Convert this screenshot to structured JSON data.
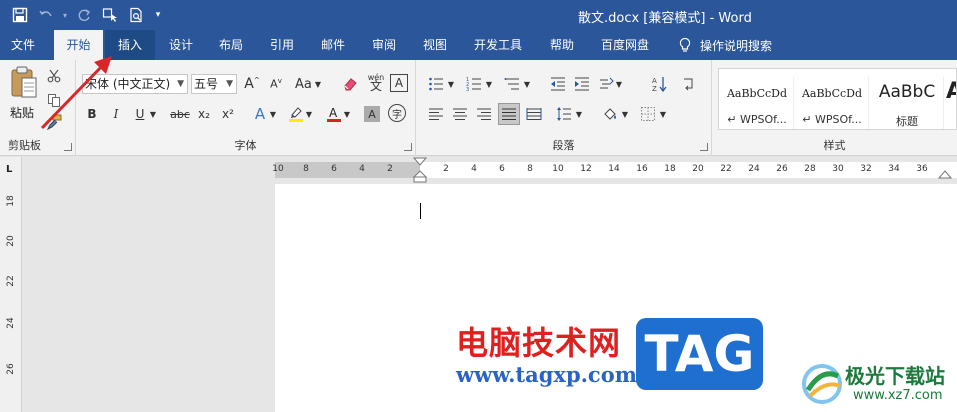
{
  "window": {
    "title": "散文.docx [兼容模式]  -  Word"
  },
  "tabs": [
    {
      "label": "文件",
      "state": "normal"
    },
    {
      "label": "开始",
      "state": "active"
    },
    {
      "label": "插入",
      "state": "hover"
    },
    {
      "label": "设计",
      "state": "normal"
    },
    {
      "label": "布局",
      "state": "normal"
    },
    {
      "label": "引用",
      "state": "normal"
    },
    {
      "label": "邮件",
      "state": "normal"
    },
    {
      "label": "审阅",
      "state": "normal"
    },
    {
      "label": "视图",
      "state": "normal"
    },
    {
      "label": "开发工具",
      "state": "normal"
    },
    {
      "label": "帮助",
      "state": "normal"
    },
    {
      "label": "百度网盘",
      "state": "normal"
    }
  ],
  "tell_me": {
    "label": "操作说明搜索",
    "icon": "lightbulb-icon"
  },
  "ribbon": {
    "clipboard": {
      "label": "剪贴板",
      "paste": "粘贴"
    },
    "font": {
      "label": "字体",
      "font_name": "宋体 (中文正文)",
      "font_size": "五号",
      "change_case": "Aa",
      "phonetic": "wén",
      "bold": "B",
      "italic": "I",
      "underline": "U",
      "strike": "abc",
      "subscript": "x₂",
      "superscript": "x²",
      "enclose": "字"
    },
    "paragraph": {
      "label": "段落"
    },
    "styles": {
      "label": "样式",
      "items": [
        {
          "sample": "AaBbCcDd",
          "name": "↵ WPSOf..."
        },
        {
          "sample": "AaBbCcDd",
          "name": "↵ WPSOf..."
        },
        {
          "sample": "AaBbC",
          "name": "标题"
        },
        {
          "sample": "A",
          "name": ""
        }
      ]
    }
  },
  "ruler": {
    "left_ticks": [
      "10",
      "8",
      "6",
      "4",
      "2"
    ],
    "right_ticks": [
      "2",
      "4",
      "6",
      "8",
      "10",
      "12",
      "14",
      "16",
      "18",
      "20",
      "22",
      "24",
      "26",
      "28",
      "30",
      "32",
      "34",
      "36"
    ],
    "vertical_ticks": [
      "18",
      "20",
      "22",
      "24",
      "26"
    ]
  },
  "watermark": {
    "cn": "电脑技术网",
    "url": "www.tagxp.com",
    "tag": "TAG",
    "site_cn": "极光下载站",
    "site_url": "www.xz7.com"
  },
  "colors": {
    "accent": "#2b579a",
    "font_color_red": "#e02020",
    "highlight_yellow": "#ffee00"
  }
}
